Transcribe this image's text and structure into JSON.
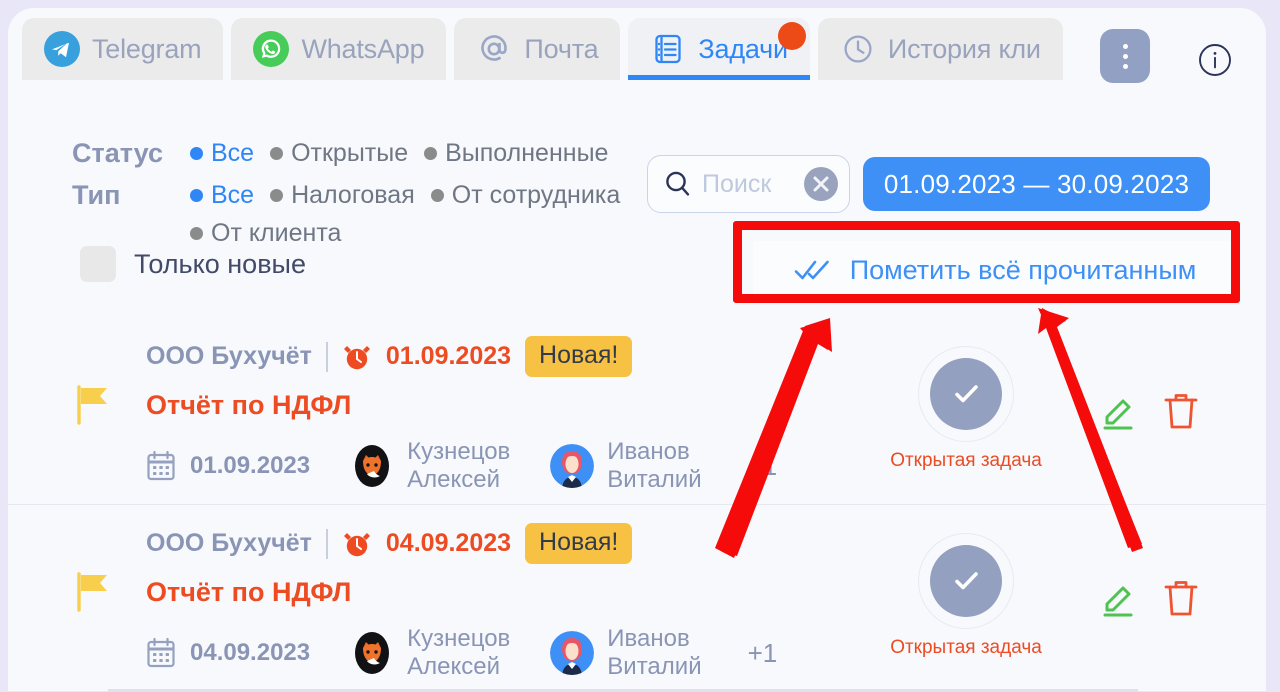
{
  "tabs": [
    {
      "id": "telegram",
      "label": "Telegram",
      "icon": "telegram-icon",
      "active": false,
      "badge": false
    },
    {
      "id": "whatsapp",
      "label": "WhatsApp",
      "icon": "whatsapp-icon",
      "active": false,
      "badge": false
    },
    {
      "id": "mail",
      "label": "Почта",
      "icon": "at-mail-icon",
      "active": false,
      "badge": false
    },
    {
      "id": "tasks",
      "label": "Задачи",
      "icon": "task-list-icon",
      "active": true,
      "badge": true
    },
    {
      "id": "history",
      "label": "История кли",
      "icon": "clock-history-icon",
      "active": false,
      "badge": false
    }
  ],
  "toolbar": {
    "more_menu": "⋮",
    "info": "i"
  },
  "filters": {
    "status": {
      "title": "Статус",
      "options": [
        {
          "label": "Все",
          "selected": true
        },
        {
          "label": "Открытые",
          "selected": false
        },
        {
          "label": "Выполненные",
          "selected": false
        }
      ]
    },
    "type": {
      "title": "Тип",
      "options": [
        {
          "label": "Все",
          "selected": true
        },
        {
          "label": "Налоговая",
          "selected": false
        },
        {
          "label": "От сотрудника",
          "selected": false
        },
        {
          "label": "От клиента",
          "selected": false
        }
      ]
    },
    "only_new": {
      "label": "Только новые",
      "checked": false
    }
  },
  "search": {
    "placeholder": "Поиск",
    "value": ""
  },
  "date_range": {
    "label": "01.09.2023 — 30.09.2023"
  },
  "mark_all_read": {
    "label": "Пометить всё прочитанным",
    "icon": "double-check-icon"
  },
  "tasks": [
    {
      "company": "ООО Бухучёт",
      "due_date": "01.09.2023",
      "badge": "Новая!",
      "title": "Отчёт по НДФЛ",
      "meta_date": "01.09.2023",
      "people": [
        {
          "first": "Кузнецов",
          "second": "Алексей",
          "avatar": "fox-avatar"
        },
        {
          "first": "Иванов",
          "second": "Виталий",
          "avatar": "woman-avatar"
        }
      ],
      "extra_people": "+1",
      "status_label": "Открытая задача"
    },
    {
      "company": "ООО Бухучёт",
      "due_date": "04.09.2023",
      "badge": "Новая!",
      "title": "Отчёт по НДФЛ",
      "meta_date": "04.09.2023",
      "people": [
        {
          "first": "Кузнецов",
          "second": "Алексей",
          "avatar": "fox-avatar"
        },
        {
          "first": "Иванов",
          "second": "Виталий",
          "avatar": "woman-avatar"
        }
      ],
      "extra_people": "+1",
      "status_label": "Открытая задача"
    }
  ],
  "colors": {
    "accent_blue": "#2f86f6",
    "badge_red": "#ec4a17",
    "task_orange": "#ed4b22",
    "new_badge_yellow": "#f7c243",
    "annotation_red": "#f60b0b",
    "muted": "#8a95b5",
    "page_bg": "#e9e7f7",
    "card_bg": "#f7f9fc"
  }
}
